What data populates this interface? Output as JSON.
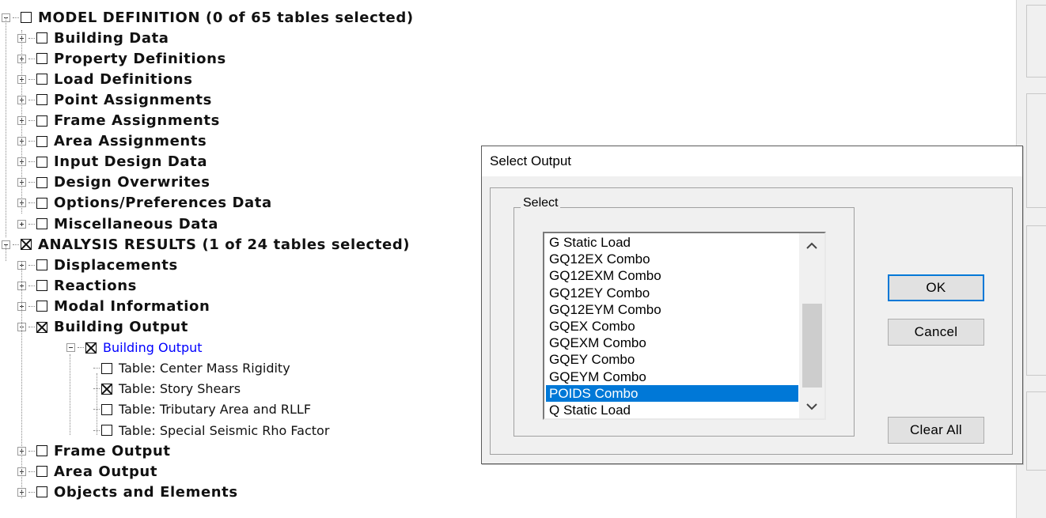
{
  "tree": {
    "nodes": [
      {
        "label": "MODEL DEFINITION  (0 of 65 tables selected)",
        "level": 0,
        "expander": "minus",
        "checked": false,
        "style": "bold"
      },
      {
        "label": "Building Data",
        "level": 1,
        "expander": "plus",
        "checked": false,
        "style": "bold"
      },
      {
        "label": "Property Definitions",
        "level": 1,
        "expander": "plus",
        "checked": false,
        "style": "bold"
      },
      {
        "label": "Load Definitions",
        "level": 1,
        "expander": "plus",
        "checked": false,
        "style": "bold"
      },
      {
        "label": "Point Assignments",
        "level": 1,
        "expander": "plus",
        "checked": false,
        "style": "bold"
      },
      {
        "label": "Frame Assignments",
        "level": 1,
        "expander": "plus",
        "checked": false,
        "style": "bold"
      },
      {
        "label": "Area Assignments",
        "level": 1,
        "expander": "plus",
        "checked": false,
        "style": "bold"
      },
      {
        "label": "Input Design Data",
        "level": 1,
        "expander": "plus",
        "checked": false,
        "style": "bold"
      },
      {
        "label": "Design Overwrites",
        "level": 1,
        "expander": "plus",
        "checked": false,
        "style": "bold"
      },
      {
        "label": "Options/Preferences Data",
        "level": 1,
        "expander": "plus",
        "checked": false,
        "style": "bold"
      },
      {
        "label": "Miscellaneous Data",
        "level": 1,
        "expander": "plus",
        "checked": false,
        "style": "bold"
      },
      {
        "label": "ANALYSIS RESULTS  (1 of 24 tables selected)",
        "level": 0,
        "expander": "minus",
        "checked": true,
        "style": "bold"
      },
      {
        "label": "Displacements",
        "level": 1,
        "expander": "plus",
        "checked": false,
        "style": "bold"
      },
      {
        "label": "Reactions",
        "level": 1,
        "expander": "plus",
        "checked": false,
        "style": "bold"
      },
      {
        "label": "Modal Information",
        "level": 1,
        "expander": "plus",
        "checked": false,
        "style": "bold"
      },
      {
        "label": "Building Output",
        "level": 1,
        "expander": "minus",
        "checked": true,
        "style": "bold"
      },
      {
        "label": "Building Output",
        "level": 2,
        "expander": "minus",
        "checked": true,
        "style": "blue"
      },
      {
        "label": "Table:  Center Mass Rigidity",
        "level": 3,
        "expander": "none",
        "checked": false,
        "style": "plain"
      },
      {
        "label": "Table:  Story Shears",
        "level": 3,
        "expander": "none",
        "checked": true,
        "style": "plain"
      },
      {
        "label": "Table:  Tributary Area and RLLF",
        "level": 3,
        "expander": "none",
        "checked": false,
        "style": "plain"
      },
      {
        "label": "Table:  Special Seismic Rho Factor",
        "level": 3,
        "expander": "none",
        "checked": false,
        "style": "plain"
      },
      {
        "label": "Frame Output",
        "level": 1,
        "expander": "plus",
        "checked": false,
        "style": "bold"
      },
      {
        "label": "Area Output",
        "level": 1,
        "expander": "plus",
        "checked": false,
        "style": "bold"
      },
      {
        "label": "Objects and Elements",
        "level": 1,
        "expander": "plus",
        "checked": false,
        "style": "bold"
      }
    ]
  },
  "dialog": {
    "title": "Select Output",
    "group_label": "Select",
    "list": {
      "items": [
        "G Static Load",
        "GQ12EX Combo",
        "GQ12EXM Combo",
        "GQ12EY Combo",
        "GQ12EYM Combo",
        "GQEX Combo",
        "GQEXM Combo",
        "GQEY Combo",
        "GQEYM Combo",
        "POIDS Combo",
        "Q Static Load"
      ],
      "selected_index": 9
    },
    "buttons": {
      "ok": "OK",
      "cancel": "Cancel",
      "clear_all": "Clear All"
    }
  }
}
